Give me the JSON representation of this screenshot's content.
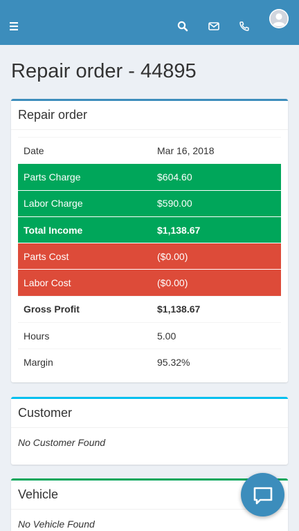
{
  "header": {
    "icons": [
      "menu-icon",
      "search-icon",
      "envelope-icon",
      "phone-icon",
      "user-avatar"
    ],
    "color": "#3c8dbc"
  },
  "page": {
    "title": "Repair order - 44895"
  },
  "repair_order": {
    "title": "Repair order",
    "rows": [
      {
        "label": "Date",
        "value": "Mar 16, 2018",
        "style": "plain"
      },
      {
        "label": "Parts Charge",
        "value": "$604.60",
        "style": "income"
      },
      {
        "label": "Labor Charge",
        "value": "$590.00",
        "style": "income"
      },
      {
        "label": "Total Income",
        "value": "$1,138.67",
        "style": "income-bold"
      },
      {
        "label": "Parts Cost",
        "value": "($0.00)",
        "style": "cost"
      },
      {
        "label": "Labor Cost",
        "value": "($0.00)",
        "style": "cost"
      },
      {
        "label": "Gross Profit",
        "value": "$1,138.67",
        "style": "bold"
      },
      {
        "label": "Hours",
        "value": "5.00",
        "style": "plain"
      },
      {
        "label": "Margin",
        "value": "95.32%",
        "style": "plain"
      }
    ]
  },
  "customer": {
    "title": "Customer",
    "empty": "No Customer Found"
  },
  "vehicle": {
    "title": "Vehicle",
    "empty": "No Vehicle Found"
  },
  "colors": {
    "income": "#00a65a",
    "cost": "#dd4b39",
    "customer_accent": "#00c0ef",
    "vehicle_accent": "#00a65a"
  },
  "chat": {
    "icon": "chat-bubble-icon"
  }
}
